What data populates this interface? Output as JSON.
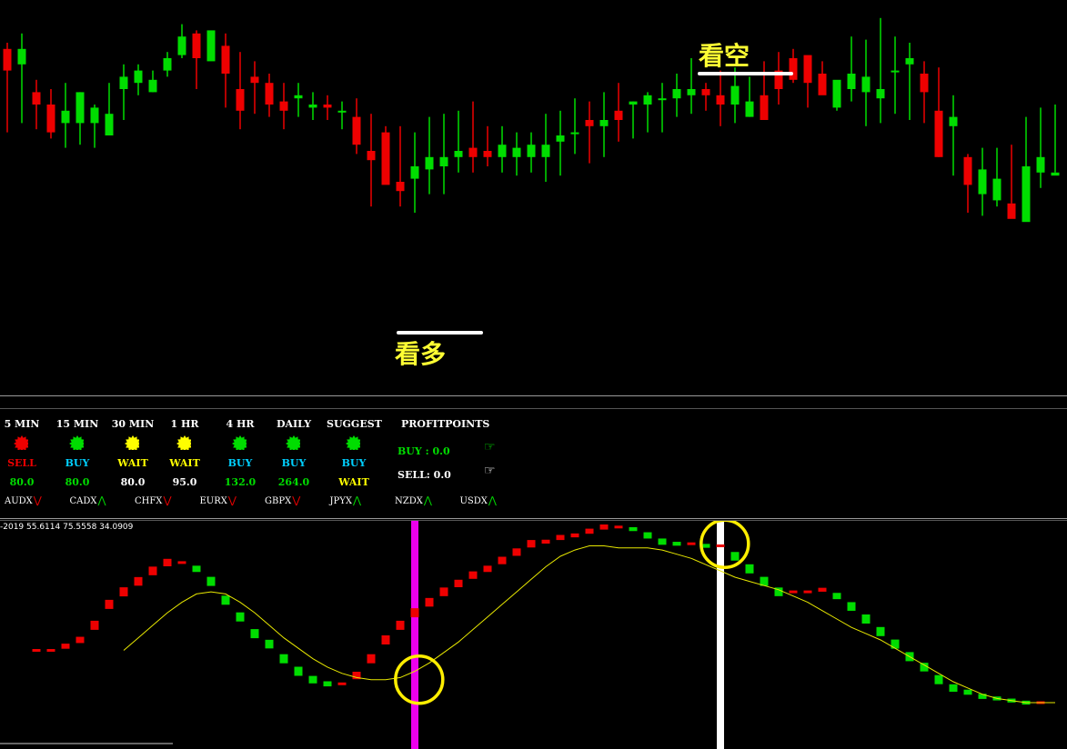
{
  "annotations": {
    "bearish": "看空",
    "bullish": "看多"
  },
  "colors": {
    "bull": "#00dd00",
    "bear": "#ee0000",
    "wait": "#ffff00",
    "buy_text": "#00cfff",
    "value_green": "#00dd00",
    "marker_line_bull": "#ee00ee",
    "marker_line_bear": "#ffffff",
    "signal_line": "#e8e800",
    "circle": "#ffee00"
  },
  "dashboard": {
    "timeframes": [
      {
        "label": "5 MIN",
        "signal": "SELL",
        "state": "bear",
        "value": "80.0"
      },
      {
        "label": "15 MIN",
        "signal": "BUY",
        "state": "bull",
        "value": "80.0"
      },
      {
        "label": "30 MIN",
        "signal": "WAIT",
        "state": "wait",
        "value": "80.0"
      },
      {
        "label": "1 HR",
        "signal": "WAIT",
        "state": "wait",
        "value": "95.0"
      },
      {
        "label": "4 HR",
        "signal": "BUY",
        "state": "bull",
        "value": "132.0"
      },
      {
        "label": "DAILY",
        "signal": "BUY",
        "state": "bull",
        "value": "264.0"
      },
      {
        "label": "SUGGEST",
        "signal": "BUY",
        "state": "bull",
        "value": "WAIT"
      }
    ],
    "profitpoints": {
      "title": "PROFITPOINTS",
      "buy": "BUY :  0.0",
      "sell": "SELL:  0.0"
    },
    "currencies": [
      {
        "name": "AUDX",
        "dir": "down"
      },
      {
        "name": "CADX",
        "dir": "up"
      },
      {
        "name": "CHFX",
        "dir": "down"
      },
      {
        "name": "EURX",
        "dir": "down"
      },
      {
        "name": "GBPX",
        "dir": "down"
      },
      {
        "name": "JPYX",
        "dir": "up"
      },
      {
        "name": "NZDX",
        "dir": "up"
      },
      {
        "name": "USDX",
        "dir": "up"
      }
    ]
  },
  "oscillator": {
    "label": "-2019 55.6114 75.5558 34.0909"
  },
  "chart_data": [
    {
      "type": "candlestick",
      "x_index": [
        0,
        1,
        2,
        3,
        4,
        5,
        6,
        7,
        8,
        9,
        10,
        11,
        12,
        13,
        14,
        15,
        16,
        17,
        18,
        19,
        20,
        21,
        22,
        23,
        24,
        25,
        26,
        27,
        28,
        29,
        30,
        31,
        32,
        33,
        34,
        35,
        36,
        37,
        38,
        39,
        40,
        41,
        42,
        43,
        44,
        45,
        46,
        47,
        48,
        49,
        50,
        51,
        52,
        53,
        54,
        55,
        56,
        57,
        58,
        59,
        60,
        61,
        62,
        63,
        64,
        65,
        66,
        67,
        68,
        69,
        70,
        71,
        72
      ],
      "open": [
        93,
        88,
        79,
        75,
        69,
        69,
        69,
        65,
        80,
        82,
        79,
        86,
        91,
        98,
        89,
        94,
        80,
        84,
        82,
        76,
        77,
        74,
        75,
        73,
        71,
        60,
        66,
        50,
        51,
        54,
        55,
        58,
        61,
        60,
        58,
        58,
        58,
        58,
        63,
        66,
        70,
        68,
        73,
        75,
        75,
        77,
        77,
        78,
        80,
        78,
        75,
        71,
        78,
        86,
        90,
        91,
        85,
        74,
        80,
        79,
        77,
        86,
        88,
        85,
        73,
        68,
        58,
        46,
        44,
        43,
        37,
        53,
        52
      ],
      "high": [
        95,
        98,
        83,
        80,
        82,
        79,
        75,
        82,
        88,
        88,
        86,
        92,
        101,
        99,
        95,
        98,
        92,
        89,
        85,
        82,
        82,
        79,
        78,
        76,
        77,
        72,
        68,
        68,
        66,
        71,
        72,
        73,
        76,
        68,
        68,
        66,
        66,
        72,
        73,
        77,
        76,
        79,
        82,
        76,
        79,
        82,
        85,
        90,
        82,
        86,
        87,
        84,
        89,
        92,
        93,
        85,
        89,
        79,
        97,
        96,
        103,
        97,
        95,
        89,
        87,
        78,
        59,
        61,
        61,
        62,
        71,
        74,
        75
      ],
      "low": [
        66,
        69,
        67,
        64,
        61,
        62,
        61,
        69,
        70,
        78,
        79,
        84,
        90,
        80,
        90,
        74,
        67,
        72,
        71,
        67,
        71,
        70,
        70,
        67,
        59,
        42,
        50,
        42,
        40,
        46,
        46,
        53,
        53,
        55,
        53,
        52,
        53,
        50,
        52,
        59,
        56,
        58,
        63,
        64,
        66,
        66,
        71,
        72,
        73,
        68,
        69,
        71,
        74,
        75,
        82,
        74,
        82,
        73,
        76,
        68,
        69,
        72,
        70,
        69,
        58,
        52,
        40,
        39,
        42,
        43,
        42,
        48,
        53
      ],
      "close": [
        86,
        93,
        75,
        66,
        73,
        79,
        74,
        72,
        84,
        86,
        83,
        90,
        97,
        90,
        99,
        85,
        73,
        82,
        75,
        73,
        78,
        75,
        74,
        73,
        62,
        57,
        49,
        47,
        55,
        58,
        58,
        60,
        58,
        58,
        62,
        61,
        62,
        62,
        65,
        66,
        68,
        70,
        70,
        76,
        78,
        77,
        80,
        80,
        78,
        75,
        81,
        76,
        70,
        80,
        83,
        82,
        78,
        83,
        85,
        84,
        80,
        86,
        90,
        79,
        58,
        71,
        49,
        54,
        51,
        38,
        55,
        58,
        53
      ],
      "annotations": [
        "看空",
        "看多"
      ]
    },
    {
      "type": "bar",
      "x_index": [
        2,
        3,
        4,
        5,
        6,
        7,
        8,
        9,
        10,
        11,
        12,
        13,
        14,
        15,
        16,
        17,
        18,
        19,
        20,
        21,
        22,
        23,
        24,
        25,
        26,
        27,
        28,
        29,
        30,
        31,
        32,
        33,
        34,
        35,
        36,
        37,
        38,
        39,
        40,
        41,
        42,
        43,
        44,
        45,
        46,
        47,
        48,
        49,
        50,
        51,
        52,
        53,
        54,
        55,
        56,
        57,
        58,
        59,
        60,
        61,
        62,
        63,
        64,
        65,
        66,
        67,
        68,
        69,
        70,
        71
      ],
      "histogram": [
        25,
        25,
        27,
        30,
        37,
        47,
        53,
        58,
        63,
        67,
        67,
        64,
        58,
        49,
        41,
        33,
        28,
        21,
        15,
        11,
        9,
        9,
        13,
        21,
        30,
        37,
        43,
        48,
        53,
        57,
        61,
        64,
        68,
        72,
        76,
        77,
        79,
        80,
        82,
        84,
        84,
        83,
        80,
        77,
        76,
        76,
        75,
        75,
        70,
        64,
        58,
        53,
        53,
        53,
        54,
        51,
        46,
        40,
        34,
        28,
        22,
        17,
        11,
        7,
        5,
        3,
        2,
        1,
        0,
        0
      ],
      "signal_line": {
        "x_index": [
          8,
          9,
          10,
          11,
          12,
          13,
          14,
          15,
          16,
          17,
          18,
          19,
          20,
          21,
          22,
          23,
          24,
          25,
          26,
          27,
          28,
          29,
          30,
          31,
          32,
          33,
          34,
          35,
          36,
          37,
          38,
          39,
          40,
          41,
          42,
          43,
          44,
          45,
          46,
          47,
          48,
          49,
          50,
          51,
          52,
          53,
          54,
          55,
          56,
          57,
          58,
          59,
          60,
          61,
          62,
          63,
          64,
          65,
          66,
          67,
          68,
          69,
          70,
          71,
          72
        ],
        "values": [
          25,
          31,
          37,
          43,
          48,
          52,
          53,
          52,
          48,
          43,
          37,
          31,
          26,
          21,
          17,
          14,
          12,
          11,
          11,
          12,
          15,
          19,
          24,
          29,
          35,
          41,
          47,
          53,
          59,
          65,
          70,
          73,
          75,
          75,
          74,
          74,
          74,
          73,
          71,
          69,
          66,
          63,
          60,
          58,
          56,
          54,
          51,
          48,
          44,
          40,
          36,
          33,
          30,
          26,
          22,
          18,
          14,
          10,
          7,
          4,
          2,
          1,
          0,
          0,
          0
        ]
      },
      "vertical_markers": [
        {
          "x_index": 28,
          "type": "bull"
        },
        {
          "x_index": 49,
          "type": "bear"
        }
      ],
      "circles": [
        {
          "x_index": 28.3,
          "value": 11
        },
        {
          "x_index": 49.3,
          "value": 76
        }
      ]
    }
  ]
}
